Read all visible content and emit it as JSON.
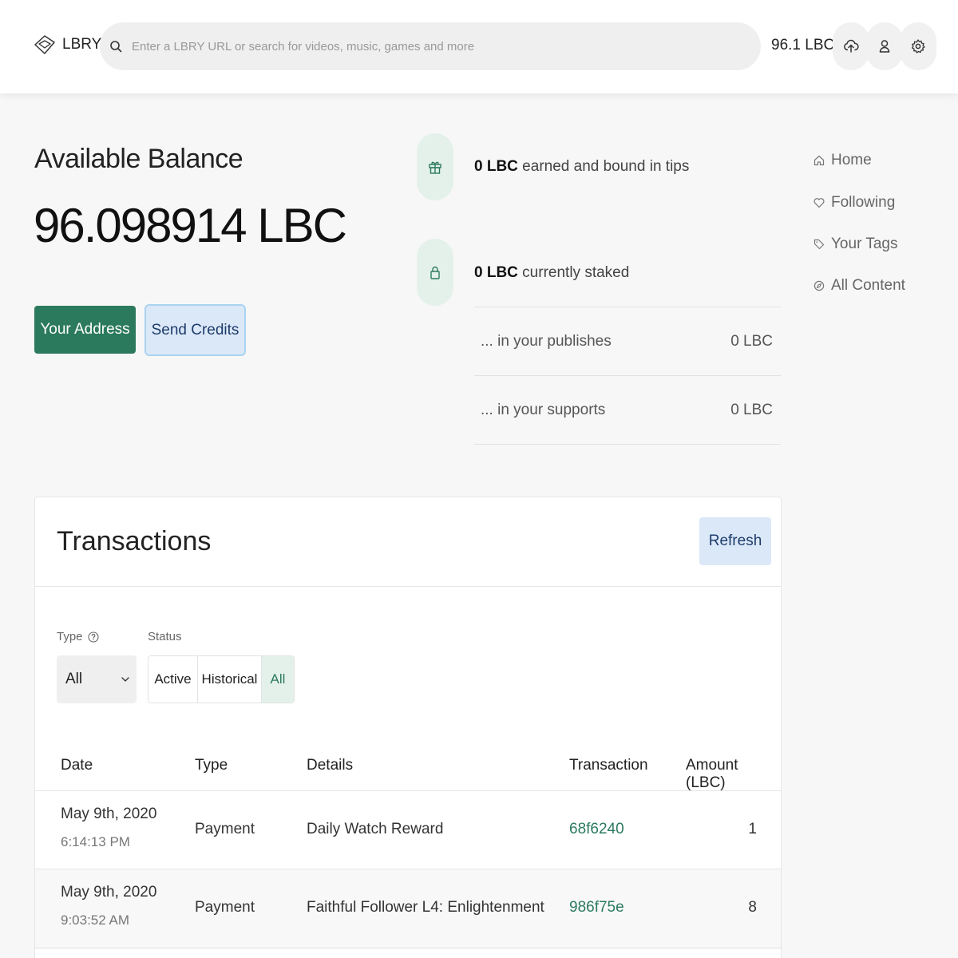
{
  "header": {
    "logo_text": "LBRY",
    "search_placeholder": "Enter a LBRY URL or search for videos, music, games and more",
    "balance": "96.1 LBC",
    "icons": [
      "publish-icon",
      "account-icon",
      "settings-icon"
    ]
  },
  "balance": {
    "title": "Available Balance",
    "amount": "96.098914 LBC",
    "address_button": "Your Address",
    "send_button": "Send Credits"
  },
  "stats": {
    "tips_amount": "0 LBC",
    "tips_text": " earned and bound in tips",
    "staked_amount": "0 LBC",
    "staked_text": " currently staked",
    "publishes_label": "... in your publishes",
    "publishes_value": "0 LBC",
    "supports_label": "... in your supports",
    "supports_value": "0 LBC"
  },
  "nav": {
    "items": [
      {
        "label": "Home",
        "icon": "home-icon"
      },
      {
        "label": "Following",
        "icon": "heart-icon"
      },
      {
        "label": "Your Tags",
        "icon": "tag-icon"
      },
      {
        "label": "All Content",
        "icon": "compass-icon"
      }
    ]
  },
  "transactions": {
    "title": "Transactions",
    "refresh_button": "Refresh",
    "type_label": "Type",
    "type_value": "All",
    "status_label": "Status",
    "status_options": [
      "Active",
      "Historical",
      "All"
    ],
    "status_selected": "All",
    "columns": [
      "Date",
      "Type",
      "Details",
      "Transaction",
      "Amount (LBC)"
    ],
    "rows": [
      {
        "date": "May 9th, 2020",
        "time": "6:14:13 PM",
        "type": "Payment",
        "details": "Daily Watch Reward",
        "txid": "68f6240",
        "amount": "1"
      },
      {
        "date": "May 9th, 2020",
        "time": "9:03:52 AM",
        "type": "Payment",
        "details": "Faithful Follower L4: Enlightenment",
        "txid": "986f75e",
        "amount": "8"
      }
    ]
  },
  "colors": {
    "accent_green": "#2c7a5e",
    "light_blue": "#dbe8f8",
    "light_green": "#e4f1eb"
  }
}
